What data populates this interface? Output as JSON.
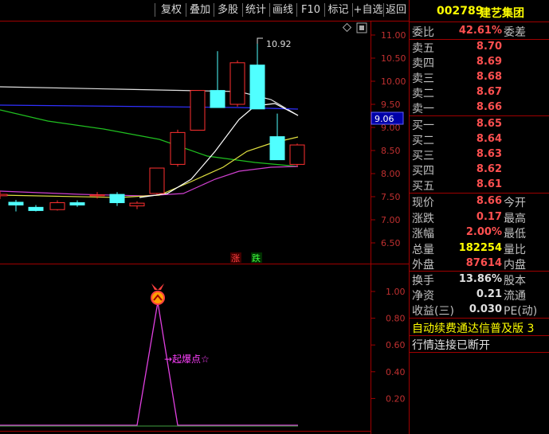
{
  "toolbar": {
    "buttons": [
      "复权",
      "叠加",
      "多股",
      "统计",
      "画线",
      "F10",
      "标记",
      "+自选",
      "返回"
    ]
  },
  "stock": {
    "code": "002789",
    "name": "建艺集团"
  },
  "chart_data": [
    {
      "type": "candlestick",
      "title": "",
      "y_ticks": [
        "11.00",
        "10.50",
        "10.00",
        "9.50",
        "9.00",
        "8.50",
        "8.00",
        "7.50",
        "7.00",
        "6.50"
      ],
      "ylim": [
        6.2,
        11.25
      ],
      "highlight_price": "9.06",
      "peak_label": "10.92",
      "rise_label": "涨",
      "fall_label": "跌",
      "candles": [
        {
          "open": 7.52,
          "close": 7.55,
          "high": 7.62,
          "low": 7.45
        },
        {
          "open": 7.38,
          "close": 7.32,
          "high": 7.43,
          "low": 7.18
        },
        {
          "open": 7.27,
          "close": 7.2,
          "high": 7.32,
          "low": 7.18
        },
        {
          "open": 7.22,
          "close": 7.37,
          "high": 7.42,
          "low": 7.2
        },
        {
          "open": 7.37,
          "close": 7.32,
          "high": 7.42,
          "low": 7.28
        },
        {
          "open": 7.52,
          "close": 7.54,
          "high": 7.6,
          "low": 7.46
        },
        {
          "open": 7.55,
          "close": 7.37,
          "high": 7.6,
          "low": 7.3
        },
        {
          "open": 7.3,
          "close": 7.36,
          "high": 7.4,
          "low": 7.23
        },
        {
          "open": 7.57,
          "close": 8.12,
          "high": 8.12,
          "low": 7.55
        },
        {
          "open": 8.2,
          "close": 8.89,
          "high": 8.95,
          "low": 8.15
        },
        {
          "open": 8.94,
          "close": 9.8,
          "high": 9.8,
          "low": 8.94
        },
        {
          "open": 9.8,
          "close": 9.43,
          "high": 10.65,
          "low": 9.43
        },
        {
          "open": 9.5,
          "close": 10.4,
          "high": 10.45,
          "low": 9.45
        },
        {
          "open": 10.35,
          "close": 9.4,
          "high": 10.92,
          "low": 9.4
        },
        {
          "open": 8.8,
          "close": 8.3,
          "high": 9.3,
          "low": 8.3
        },
        {
          "open": 8.2,
          "close": 8.62,
          "high": 8.65,
          "low": 8.15
        }
      ]
    },
    {
      "type": "line",
      "y_ticks": [
        "1.00",
        "0.80",
        "0.60",
        "0.40",
        "0.20"
      ],
      "ylim": [
        0,
        1.1
      ],
      "annotation": "→起爆点☆",
      "values": [
        0,
        0,
        0,
        0,
        0,
        0,
        0,
        0,
        1,
        0,
        0,
        0,
        0,
        0,
        0,
        0
      ]
    }
  ],
  "quote": {
    "weibi": {
      "label": "委比",
      "value": "42.61%",
      "label2": "委差"
    },
    "sells": [
      {
        "label": "卖五",
        "price": "8.70"
      },
      {
        "label": "卖四",
        "price": "8.69"
      },
      {
        "label": "卖三",
        "price": "8.68"
      },
      {
        "label": "卖二",
        "price": "8.67"
      },
      {
        "label": "卖一",
        "price": "8.66"
      }
    ],
    "buys": [
      {
        "label": "买一",
        "price": "8.65"
      },
      {
        "label": "买二",
        "price": "8.64"
      },
      {
        "label": "买三",
        "price": "8.63"
      },
      {
        "label": "买四",
        "price": "8.62"
      },
      {
        "label": "买五",
        "price": "8.61"
      }
    ],
    "stats": [
      {
        "label": "现价",
        "value": "8.66",
        "label2": "今开"
      },
      {
        "label": "涨跌",
        "value": "0.17",
        "label2": "最高"
      },
      {
        "label": "涨幅",
        "value": "2.00%",
        "label2": "最低"
      },
      {
        "label": "总量",
        "value": "182254",
        "label2": "量比"
      },
      {
        "label": "外盘",
        "value": "87614",
        "label2": "内盘"
      }
    ],
    "finance": [
      {
        "label": "换手",
        "value": "13.86%",
        "label2": "股本"
      },
      {
        "label": "净资",
        "value": "0.21",
        "label2": "流通"
      },
      {
        "label": "收益(三)",
        "value": "0.030",
        "label2": "PE(动)"
      }
    ],
    "ad": "自动续费通达信普及版  3",
    "status": "行情连接已断开"
  }
}
